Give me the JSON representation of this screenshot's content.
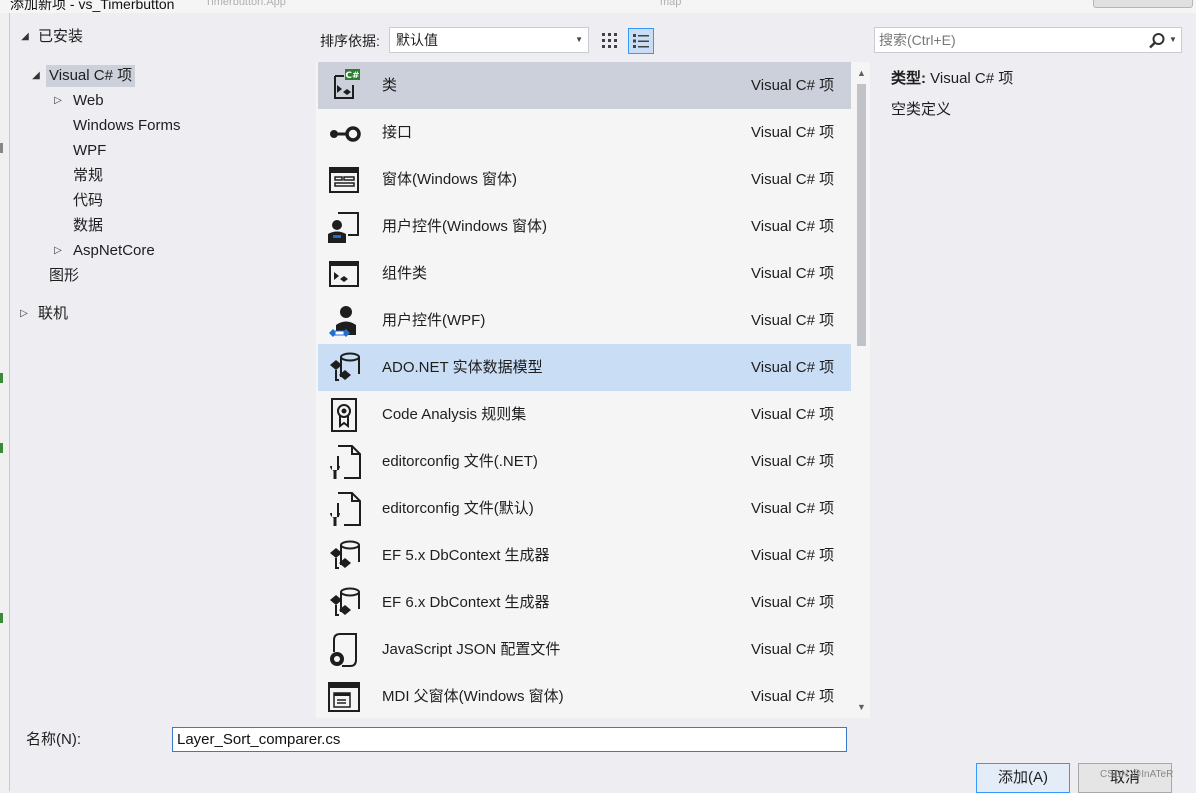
{
  "window": {
    "title": "添加新项 - vs_Timerbutton",
    "ghost_tab_1": "Timerbutton.App",
    "ghost_tab_2": "map"
  },
  "tree": {
    "installed": "已安装",
    "visual_csharp": "Visual C# 项",
    "web": "Web",
    "windows_forms": "Windows Forms",
    "wpf": "WPF",
    "general": "常规",
    "code": "代码",
    "data": "数据",
    "aspnetcore": "AspNetCore",
    "graphics": "图形",
    "online": "联机"
  },
  "toolbar": {
    "sort_label": "排序依据:",
    "sort_value": "默认值",
    "search_placeholder": "搜索(Ctrl+E)"
  },
  "items": [
    {
      "name": "类",
      "type": "Visual C# 项",
      "icon": "class-icon"
    },
    {
      "name": "接口",
      "type": "Visual C# 项",
      "icon": "interface-icon"
    },
    {
      "name": "窗体(Windows 窗体)",
      "type": "Visual C# 项",
      "icon": "form-icon"
    },
    {
      "name": "用户控件(Windows 窗体)",
      "type": "Visual C# 项",
      "icon": "user-control-icon"
    },
    {
      "name": "组件类",
      "type": "Visual C# 项",
      "icon": "component-icon"
    },
    {
      "name": "用户控件(WPF)",
      "type": "Visual C# 项",
      "icon": "wpf-user-control-icon"
    },
    {
      "name": "ADO.NET 实体数据模型",
      "type": "Visual C# 项",
      "icon": "entity-model-icon"
    },
    {
      "name": "Code Analysis 规则集",
      "type": "Visual C# 项",
      "icon": "ruleset-icon"
    },
    {
      "name": "editorconfig 文件(.NET)",
      "type": "Visual C# 项",
      "icon": "config-file-icon"
    },
    {
      "name": "editorconfig 文件(默认)",
      "type": "Visual C# 项",
      "icon": "config-file-icon"
    },
    {
      "name": "EF 5.x DbContext 生成器",
      "type": "Visual C# 项",
      "icon": "dbcontext-icon"
    },
    {
      "name": "EF 6.x DbContext 生成器",
      "type": "Visual C# 项",
      "icon": "dbcontext-icon"
    },
    {
      "name": "JavaScript JSON 配置文件",
      "type": "Visual C# 项",
      "icon": "json-config-icon"
    },
    {
      "name": "MDI 父窗体(Windows 窗体)",
      "type": "Visual C# 项",
      "icon": "mdi-form-icon"
    }
  ],
  "details": {
    "type_label": "类型:",
    "type_value": "Visual C# 项",
    "description": "空类定义"
  },
  "name_field": {
    "label": "名称(N):",
    "value": "Layer_Sort_comparer.cs"
  },
  "buttons": {
    "add": "添加(A)",
    "cancel": "取消"
  },
  "watermark": "CSDN @InATeR",
  "colors": {
    "background": "#eeeef2",
    "selection_gray": "#ccd0da",
    "selection_blue": "#c9ddf4",
    "accent": "#3399ff"
  }
}
